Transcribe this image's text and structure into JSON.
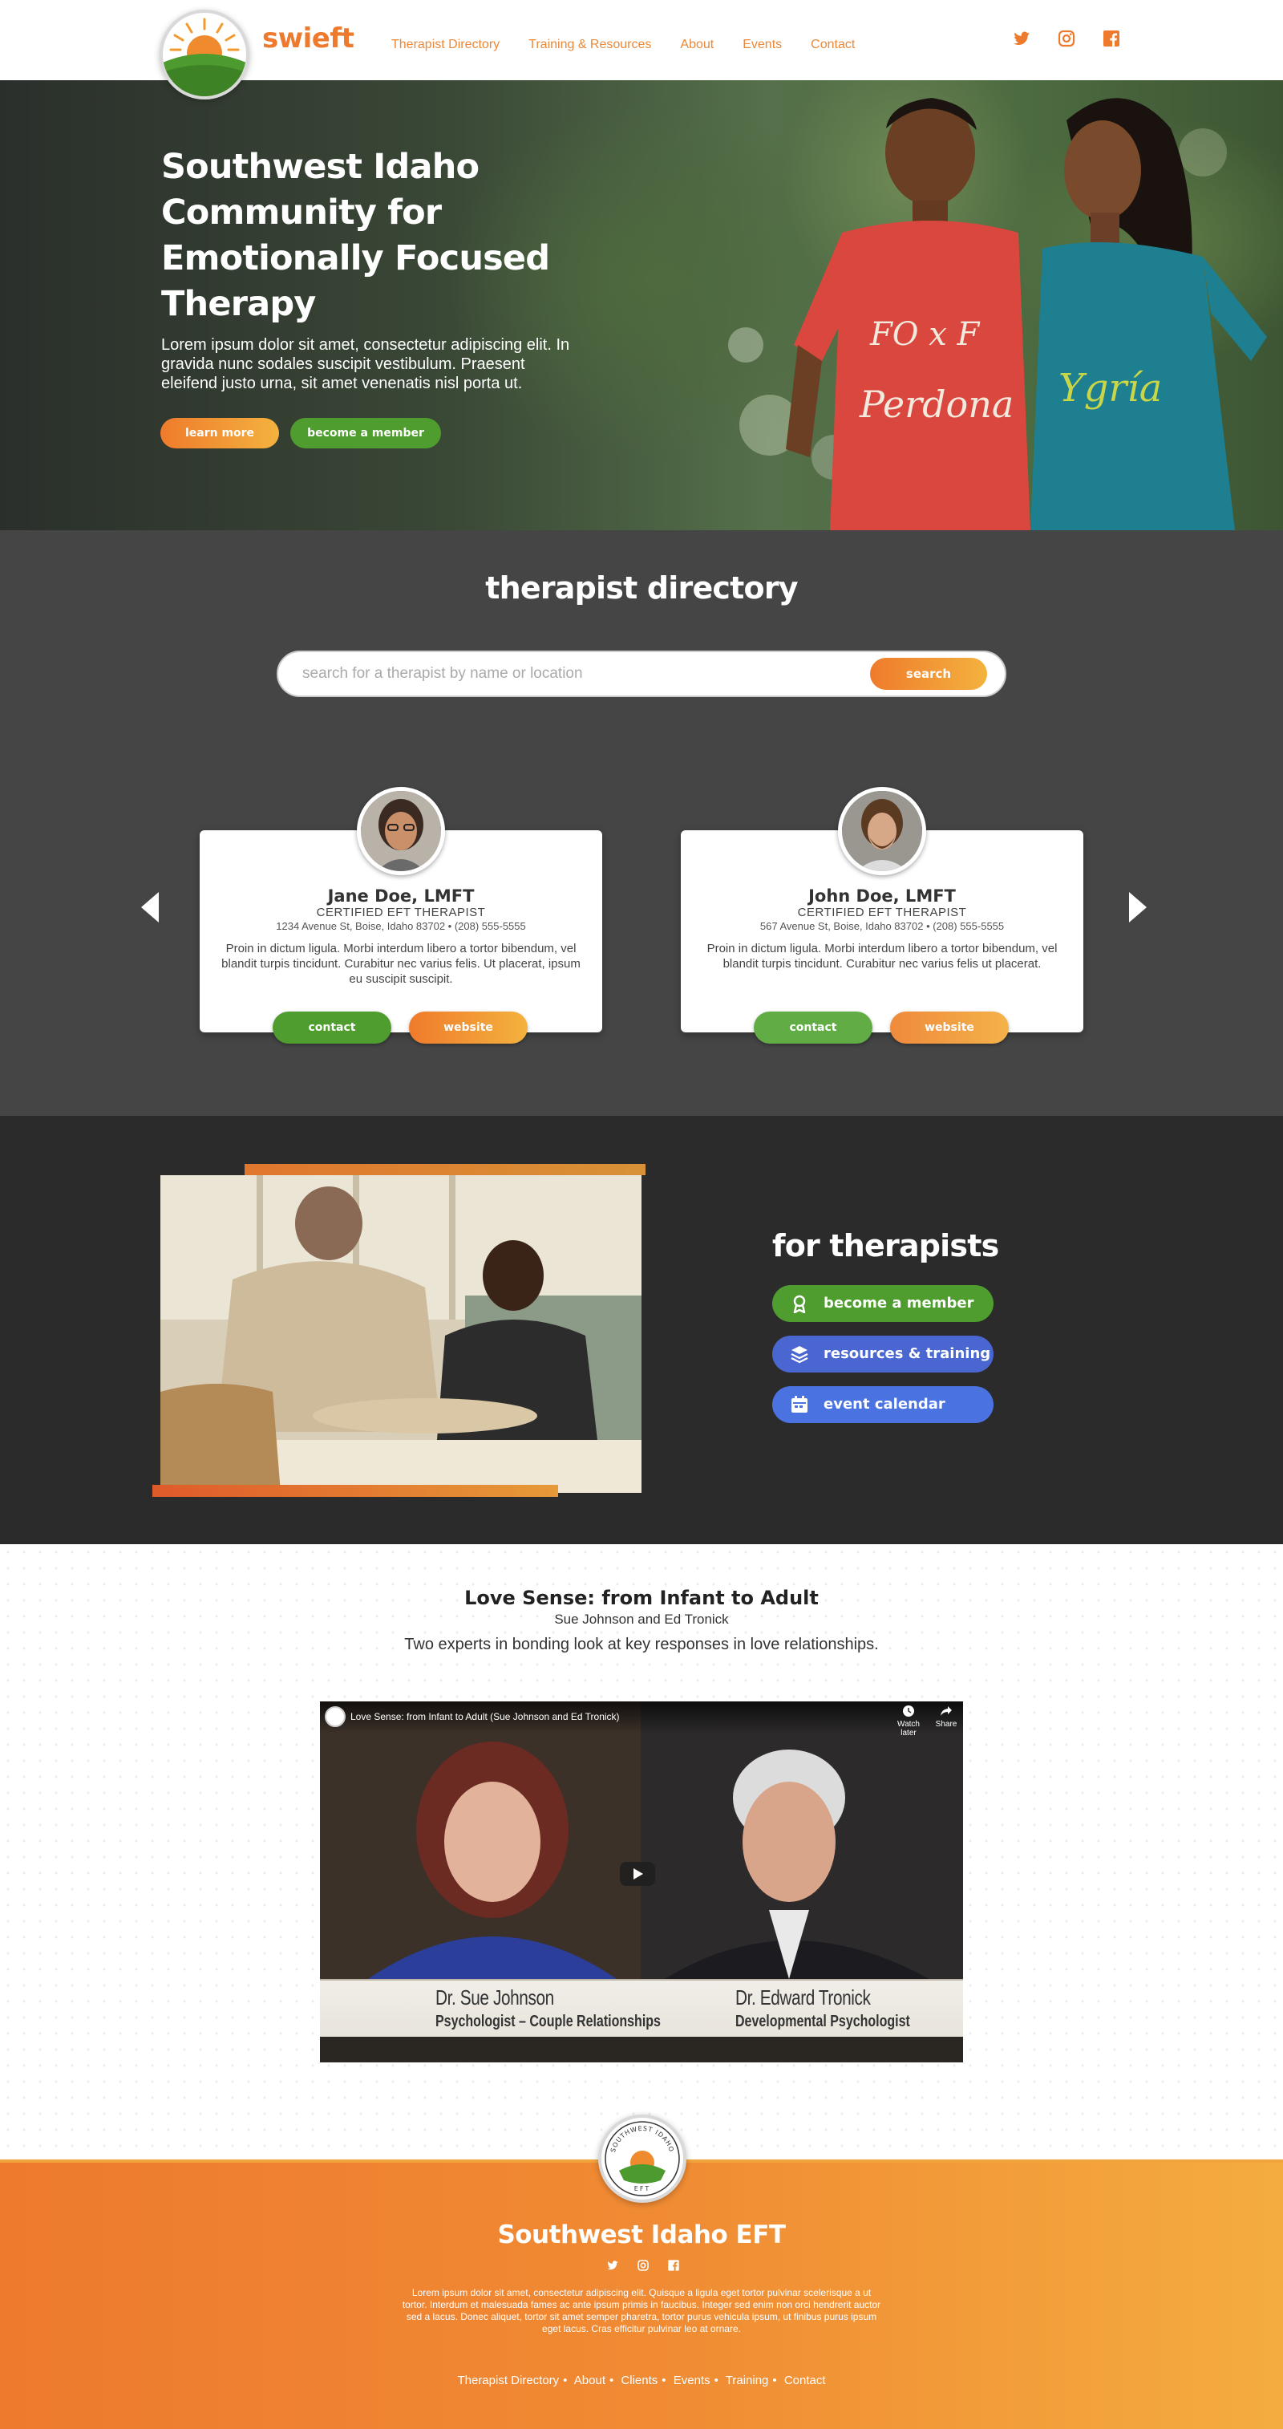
{
  "header": {
    "brand": "swieft",
    "nav": [
      "Therapist Directory",
      "Training & Resources",
      "About",
      "Events",
      "Contact"
    ],
    "social_icons": [
      "twitter-icon",
      "instagram-icon",
      "facebook-icon"
    ],
    "accent_color": "#ee7a2e"
  },
  "hero": {
    "title": "Southwest Idaho Community for Emotionally Focused Therapy",
    "text": "Lorem ipsum dolor sit amet, consectetur adipiscing elit. In gravida nunc sodales suscipit vestibulum. Praesent eleifend justo urna, sit amet venenatis nisl porta ut.",
    "btn_learn": "learn more",
    "btn_member": "become a member"
  },
  "directory": {
    "title": "therapist directory",
    "search_placeholder": "search for a therapist by name or location",
    "search_btn": "search",
    "cards": [
      {
        "name": "Jane Doe, LMFT",
        "credential": "CERTIFIED EFT THERAPIST",
        "address": "1234 Avenue St, Boise, Idaho 83702  • (208) 555-5555",
        "bio": "Proin in dictum ligula. Morbi interdum libero a tortor bibendum, vel blandit turpis tincidunt. Curabitur nec varius felis. Ut placerat, ipsum eu suscipit suscipit.",
        "contact": "contact",
        "website": "website"
      },
      {
        "name": "John Doe, LMFT",
        "credential": "CERTIFIED EFT THERAPIST",
        "address": "567 Avenue St, Boise, Idaho 83702  • (208) 555-5555",
        "bio": "Proin in dictum ligula. Morbi interdum libero a tortor bibendum, vel blandit turpis tincidunt. Curabitur nec varius felis ut placerat.",
        "contact": "contact",
        "website": "website"
      }
    ]
  },
  "therapists": {
    "title": "for therapists",
    "buttons": [
      {
        "label": "become a member",
        "icon": "award-ribbon-icon",
        "color": "#4f9d2f"
      },
      {
        "label": "resources & training",
        "icon": "layers-icon",
        "color": "#4a66d0"
      },
      {
        "label": "event calendar",
        "icon": "calendar-icon",
        "color": "#4a72e0"
      }
    ]
  },
  "video": {
    "title": "Love Sense: from Infant to Adult",
    "authors": "Sue Johnson and Ed Tronick",
    "description": "Two experts in bonding look at key responses in love relationships.",
    "player_title": "Love Sense: from Infant to Adult (Sue Johnson and Ed Tronick)",
    "watch_later": "Watch later",
    "share": "Share",
    "caption_left_name": "Dr. Sue Johnson",
    "caption_left_role": "Psychologist – Couple Relationships",
    "caption_right_name": "Dr. Edward Tronick",
    "caption_right_role": "Developmental Psychologist"
  },
  "footer": {
    "badge_text_top": "SOUTHWEST IDAHO",
    "badge_text_bottom": "EFT",
    "title": "Southwest Idaho EFT",
    "text": "Lorem ipsum dolor sit amet, consectetur adipiscing elit. Quisque a ligula eget tortor pulvinar scelerisque a ut tortor. Interdum et malesuada fames ac ante ipsum primis in faucibus. Integer sed enim non orci hendrerit auctor sed a lacus. Donec aliquet, tortor sit amet semper pharetra, tortor purus vehicula ipsum, ut finibus purus ipsum eget lacus. Cras efficitur pulvinar leo at ornare.",
    "nav": [
      "Therapist Directory",
      "About",
      "Clients",
      "Events",
      "Training",
      "Contact"
    ]
  }
}
